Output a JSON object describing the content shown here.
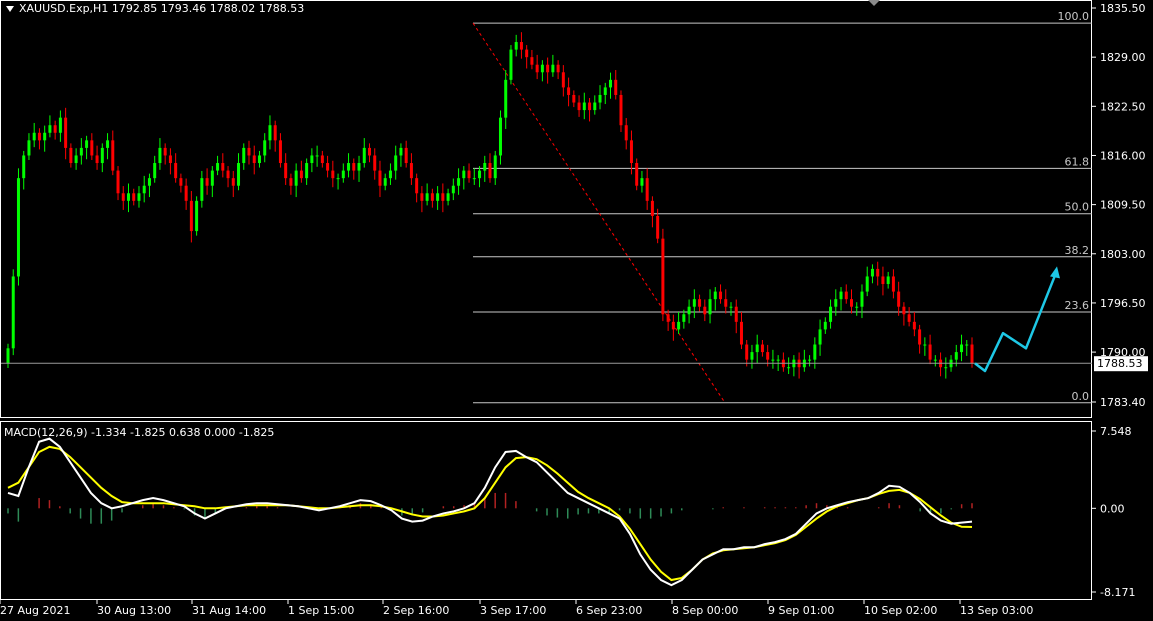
{
  "header": {
    "symbol_info": "XAUUSD.Exp,H1  1792.85 1793.46 1788.02 1788.53",
    "macd_info": "MACD(12,26,9) -1.334 -1.825 0.638 0.000 -1.825"
  },
  "colors": {
    "background": "#000000",
    "bull_candle": "#00ff00",
    "bear_candle": "#ff0000",
    "macd_line": "#ffffff",
    "signal_line": "#ffff00",
    "hist_positive": "#b22222",
    "hist_negative": "#2e8b57",
    "fib_lines": "#c8c8c8",
    "fib_trendline": "#ff0000",
    "forecast_arrow": "#1ec8e6",
    "axis": "#ffffff"
  },
  "chart_data": [
    {
      "type": "candlestick",
      "title": "XAUUSD.Exp,H1",
      "ohlc_last": {
        "open": 1792.85,
        "high": 1793.46,
        "low": 1788.02,
        "close": 1788.53
      },
      "current_price": 1788.53,
      "ylim": [
        1780.5,
        1835.5
      ],
      "y_ticks": [
        "1835.50",
        "1829.00",
        "1822.50",
        "1816.00",
        "1809.50",
        "1803.00",
        "1796.50",
        "1790.00",
        "1783.40"
      ],
      "x_ticks": [
        "27 Aug 2021",
        "30 Aug 13:00",
        "31 Aug 14:00",
        "1 Sep 15:00",
        "2 Sep 16:00",
        "3 Sep 17:00",
        "6 Sep 23:00",
        "8 Sep 00:00",
        "9 Sep 01:00",
        "10 Sep 02:00",
        "13 Sep 03:00"
      ],
      "closes": [
        1790.5,
        1800,
        1813,
        1816,
        1818,
        1819,
        1818,
        1819,
        1820,
        1819,
        1821,
        1817,
        1815,
        1816,
        1817,
        1818,
        1816,
        1815,
        1817,
        1818,
        1814,
        1811,
        1810,
        1811,
        1810,
        1811,
        1812,
        1813,
        1815,
        1817,
        1816,
        1815,
        1813,
        1812,
        1810,
        1806,
        1810,
        1813,
        1812,
        1814,
        1815,
        1814,
        1813,
        1812,
        1815,
        1817,
        1816,
        1815,
        1816,
        1818,
        1820,
        1818,
        1815,
        1813,
        1812,
        1814,
        1813,
        1815,
        1816,
        1816,
        1815,
        1814,
        1813,
        1813,
        1814,
        1815,
        1814,
        1815,
        1817,
        1816,
        1814,
        1812,
        1813,
        1814,
        1816,
        1817,
        1815,
        1813,
        1811,
        1810,
        1811,
        1810,
        1811,
        1810,
        1811,
        1812,
        1813,
        1814,
        1813,
        1813,
        1814,
        1815,
        1813,
        1816,
        1821,
        1826,
        1830,
        1831,
        1830,
        1829,
        1828,
        1827,
        1828,
        1827,
        1828,
        1827,
        1825,
        1824,
        1823,
        1822,
        1823,
        1822,
        1823,
        1824,
        1825,
        1826,
        1824,
        1820,
        1818,
        1815,
        1812,
        1813,
        1810,
        1808,
        1805,
        1795,
        1794,
        1793,
        1794,
        1795,
        1796,
        1797,
        1796,
        1795,
        1797,
        1798,
        1797,
        1796,
        1796,
        1794,
        1791,
        1789,
        1790,
        1791,
        1790,
        1789,
        1789,
        1789,
        1788,
        1788,
        1789,
        1788,
        1789,
        1789,
        1791,
        1793,
        1794,
        1796,
        1797,
        1798,
        1797,
        1796,
        1796,
        1798,
        1800,
        1801,
        1800,
        1799,
        1800,
        1798,
        1796,
        1795,
        1794,
        1793,
        1791,
        1791,
        1789,
        1789,
        1788,
        1788,
        1789,
        1790,
        1791,
        1791,
        1788.53
      ],
      "fibonacci": {
        "levels": [
          "100.0",
          "61.8",
          "50.0",
          "38.2",
          "23.6",
          "0.0"
        ],
        "prices": [
          1833.5,
          1814.3,
          1808.3,
          1802.6,
          1795.3,
          1783.3
        ]
      },
      "forecast_path": [
        [
          1788.5,
          "start"
        ],
        [
          1787.5
        ],
        [
          1792.5
        ],
        [
          1790.5
        ],
        [
          1800.8
        ]
      ]
    },
    {
      "type": "line",
      "title": "MACD(12,26,9)",
      "values_shown": [
        -1.334,
        -1.825,
        0.638,
        0.0,
        -1.825
      ],
      "ylim": [
        -8.171,
        7.548
      ],
      "y_ticks": [
        "7.548",
        "0.00",
        "-8.171"
      ],
      "series": [
        {
          "name": "",
          "values": [
            1.5,
            1.2,
            4,
            6.5,
            6.8,
            6,
            4.5,
            3,
            1.5,
            0.5,
            0,
            0.2,
            0.5,
            0.8,
            1,
            0.8,
            0.5,
            0.2,
            -0.5,
            -1,
            -0.5,
            0,
            0.2,
            0.4,
            0.5,
            0.5,
            0.4,
            0.3,
            0.2,
            0,
            -0.2,
            0,
            0.2,
            0.5,
            0.8,
            0.7,
            0.3,
            -0.2,
            -1,
            -1.3,
            -1.2,
            -0.8,
            -0.5,
            -0.3,
            0,
            0.5,
            2,
            4,
            5.5,
            5.6,
            5,
            4.5,
            3.5,
            2.5,
            1.5,
            1,
            0.5,
            0,
            -0.5,
            -1,
            -2.5,
            -4.5,
            -6,
            -7,
            -7.5,
            -7,
            -6,
            -5,
            -4.5,
            -4,
            -4,
            -3.8,
            -3.8,
            -3.5,
            -3.3,
            -3,
            -2.5,
            -1.5,
            -0.5,
            0,
            0.3,
            0.6,
            0.8,
            1,
            1.5,
            2.2,
            2.1,
            1.5,
            0.6,
            -0.5,
            -1.2,
            -1.5,
            -1.4,
            -1.3
          ]
        },
        {
          "name": "",
          "values": [
            2,
            2.5,
            4,
            5.5,
            6,
            5.8,
            5,
            4,
            3,
            2,
            1.2,
            0.6,
            0.5,
            0.5,
            0.5,
            0.5,
            0.4,
            0.3,
            0.2,
            0,
            0,
            0.1,
            0.2,
            0.3,
            0.3,
            0.3,
            0.3,
            0.3,
            0.2,
            0.1,
            0,
            0,
            0.1,
            0.2,
            0.3,
            0.3,
            0.2,
            0,
            -0.3,
            -0.6,
            -0.8,
            -0.8,
            -0.7,
            -0.5,
            -0.3,
            0,
            1,
            2.5,
            4,
            4.9,
            5,
            4.8,
            4.2,
            3.4,
            2.5,
            1.6,
            1,
            0.5,
            0,
            -0.8,
            -2,
            -3.5,
            -5,
            -6.2,
            -7,
            -6.8,
            -6,
            -5,
            -4.4,
            -4.1,
            -4,
            -3.9,
            -3.8,
            -3.6,
            -3.4,
            -3.1,
            -2.6,
            -1.8,
            -1,
            -0.3,
            0.2,
            0.5,
            0.8,
            1,
            1.4,
            1.7,
            1.8,
            1.5,
            0.9,
            0.1,
            -0.7,
            -1.4,
            -1.8,
            -1.825
          ]
        }
      ],
      "histogram": [
        -0.5,
        -1.3,
        0,
        1,
        0.8,
        0.2,
        -0.5,
        -1,
        -1.5,
        -1.5,
        -1.2,
        -0.4,
        0,
        0.3,
        0.5,
        0.3,
        0.1,
        -0.1,
        -0.7,
        -1,
        -0.5,
        -0.1,
        0,
        0.1,
        0.2,
        0.2,
        0.1,
        0,
        0,
        -0.1,
        -0.2,
        0,
        0.1,
        0.3,
        0.5,
        0.4,
        0.1,
        -0.2,
        -0.7,
        -0.7,
        -0.4,
        0,
        0.2,
        0.2,
        0.3,
        0.5,
        1,
        1.5,
        1.5,
        0.7,
        0,
        -0.3,
        -0.7,
        -0.9,
        -1,
        -0.6,
        -0.5,
        -0.5,
        -0.5,
        -0.2,
        -0.5,
        -1,
        -1,
        -0.8,
        -0.5,
        -0.2,
        0,
        0,
        -0.1,
        0.1,
        0,
        0.1,
        0,
        0.1,
        0.1,
        0.1,
        0.1,
        0.3,
        0.5,
        0.3,
        0.1,
        0.1,
        0,
        0,
        0.1,
        0.5,
        0.3,
        0,
        -0.3,
        -0.6,
        -0.5,
        -0.1,
        0.4,
        0.5
      ]
    }
  ]
}
